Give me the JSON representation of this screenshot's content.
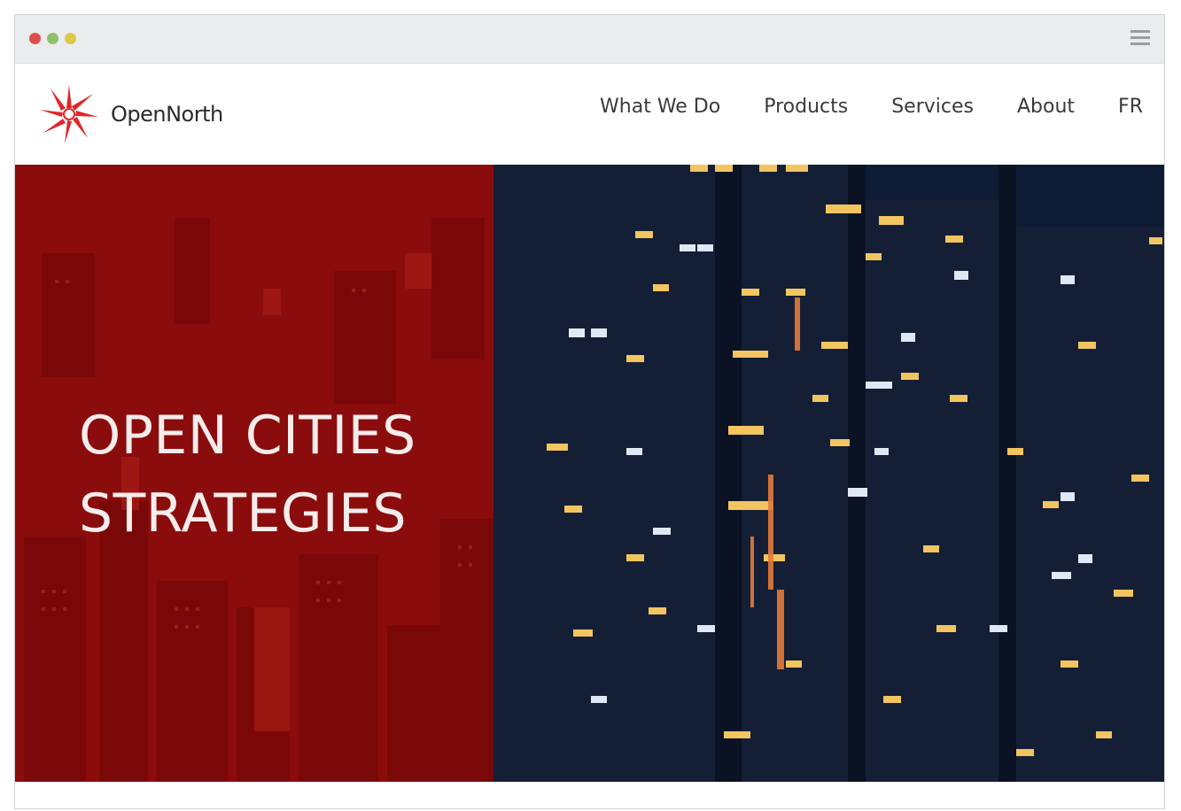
{
  "window": {
    "traffic_lights": {
      "close_color": "#e14c4c",
      "minimize_color": "#8dc06a",
      "maximize_color": "#dcc94a"
    },
    "menu_icon": "hamburger-icon"
  },
  "header": {
    "logo": {
      "text": "OpenNorth",
      "icon": "starburst-logo-icon",
      "color": "#e0262a"
    },
    "nav": [
      {
        "label": "What We Do"
      },
      {
        "label": "Products"
      },
      {
        "label": "Services"
      },
      {
        "label": "About"
      },
      {
        "label": "FR"
      }
    ]
  },
  "hero": {
    "title_line1": "OPEN CITIES",
    "title_line2": "STRATEGIES",
    "left_panel_color": "#8b0c0c",
    "right_panel_color": "#0d1a33"
  }
}
